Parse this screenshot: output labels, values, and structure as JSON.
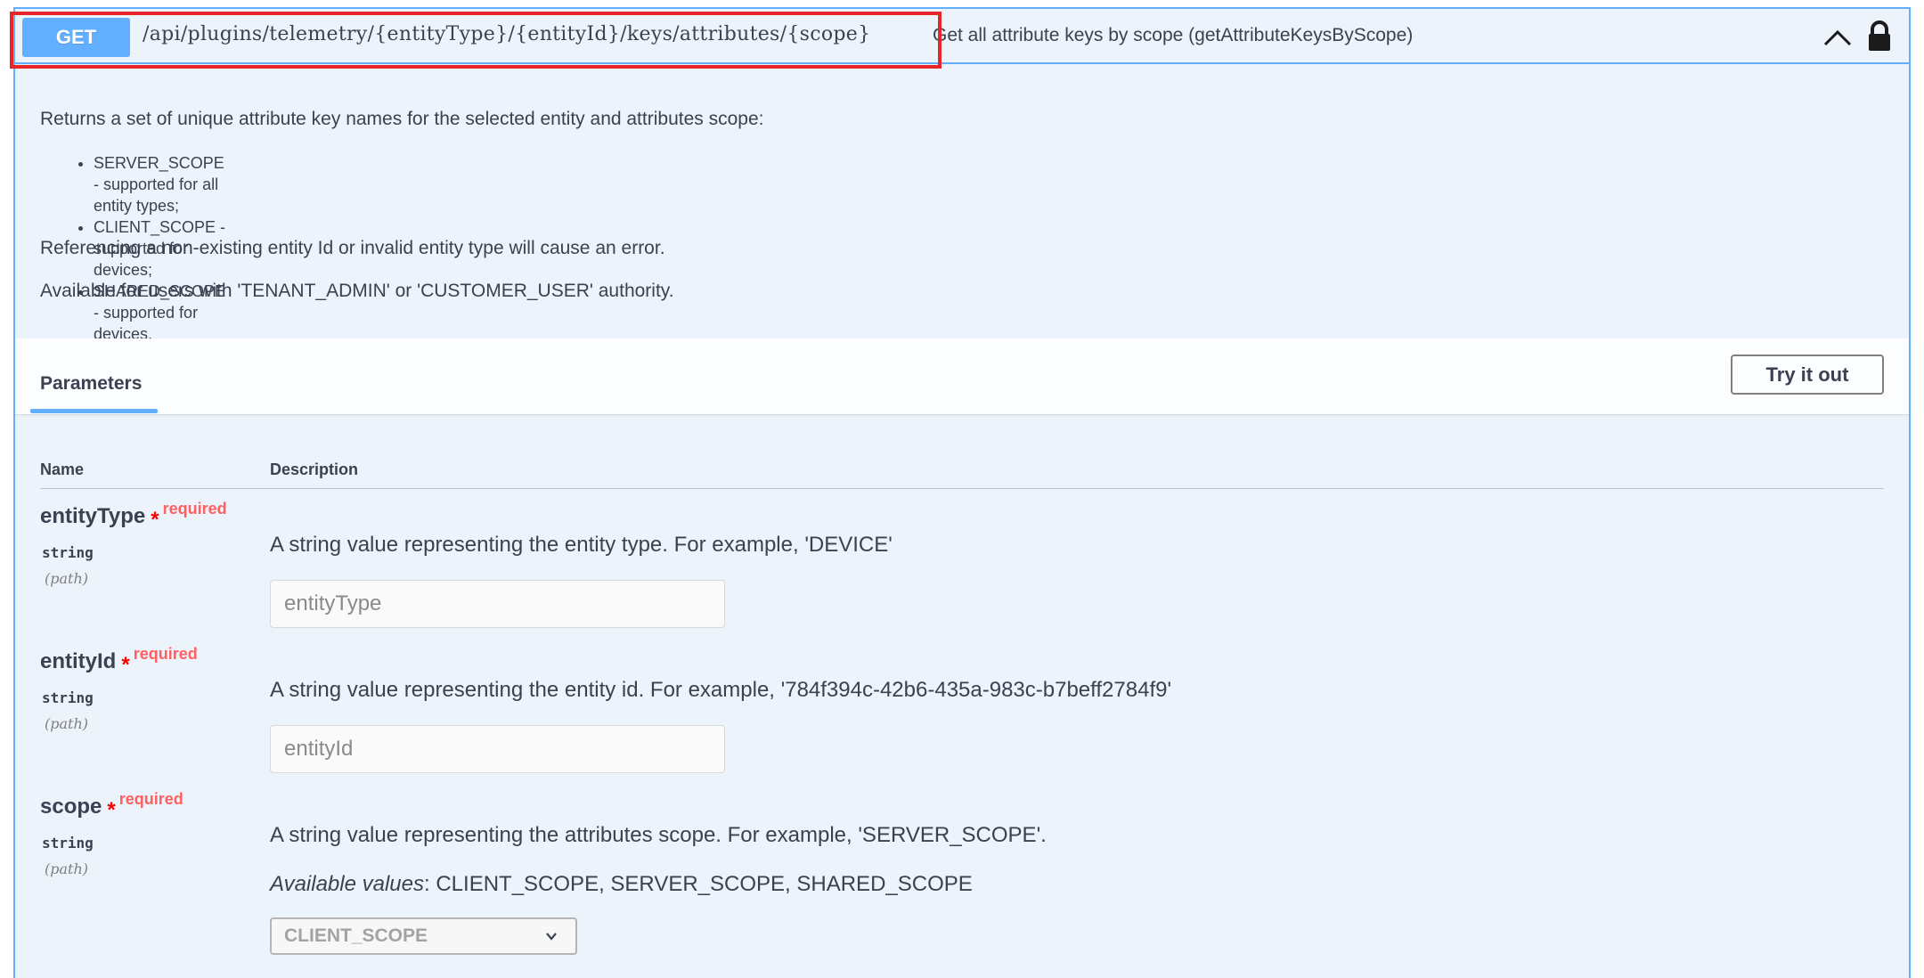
{
  "summary": {
    "method": "GET",
    "path": "/api/plugins/telemetry/{entityType}/{entityId}/keys/attributes/{scope}",
    "description": "Get all attribute keys by scope (getAttributeKeysByScope)",
    "collapse_icon": "chevron-up-icon",
    "lock_icon": "lock-icon"
  },
  "description": {
    "intro": "Returns a set of unique attribute key names for the selected entity and attributes scope:",
    "items": [
      "SERVER_SCOPE - supported for all entity types;",
      "CLIENT_SCOPE - supported for devices;",
      "SHARED_SCOPE - supported for devices."
    ],
    "error_note": "Referencing a non-existing entity Id or invalid entity type will cause an error.",
    "auth_note": "Available for users with 'TENANT_ADMIN' or 'CUSTOMER_USER' authority."
  },
  "parameters": {
    "tab_label": "Parameters",
    "try_label": "Try it out",
    "col_name": "Name",
    "col_description": "Description",
    "items": [
      {
        "name": "entityType",
        "required_star": "*",
        "required": "required",
        "type": "string",
        "in": "(path)",
        "description": "A string value representing the entity type. For example, 'DEVICE'",
        "placeholder": "entityType"
      },
      {
        "name": "entityId",
        "required_star": "*",
        "required": "required",
        "type": "string",
        "in": "(path)",
        "description": "A string value representing the entity id. For example, '784f394c-42b6-435a-983c-b7beff2784f9'",
        "placeholder": "entityId"
      },
      {
        "name": "scope",
        "required_star": "*",
        "required": "required",
        "type": "string",
        "in": "(path)",
        "description": "A string value representing the attributes scope. For example, 'SERVER_SCOPE'.",
        "available_label": "Available values",
        "available_values": ": CLIENT_SCOPE, SERVER_SCOPE, SHARED_SCOPE",
        "selected": "CLIENT_SCOPE"
      }
    ]
  },
  "colors": {
    "get_blue": "#61affe",
    "block_bg": "#ecf3fb",
    "required_red": "#ff0000",
    "highlight_red": "#e8262a"
  }
}
